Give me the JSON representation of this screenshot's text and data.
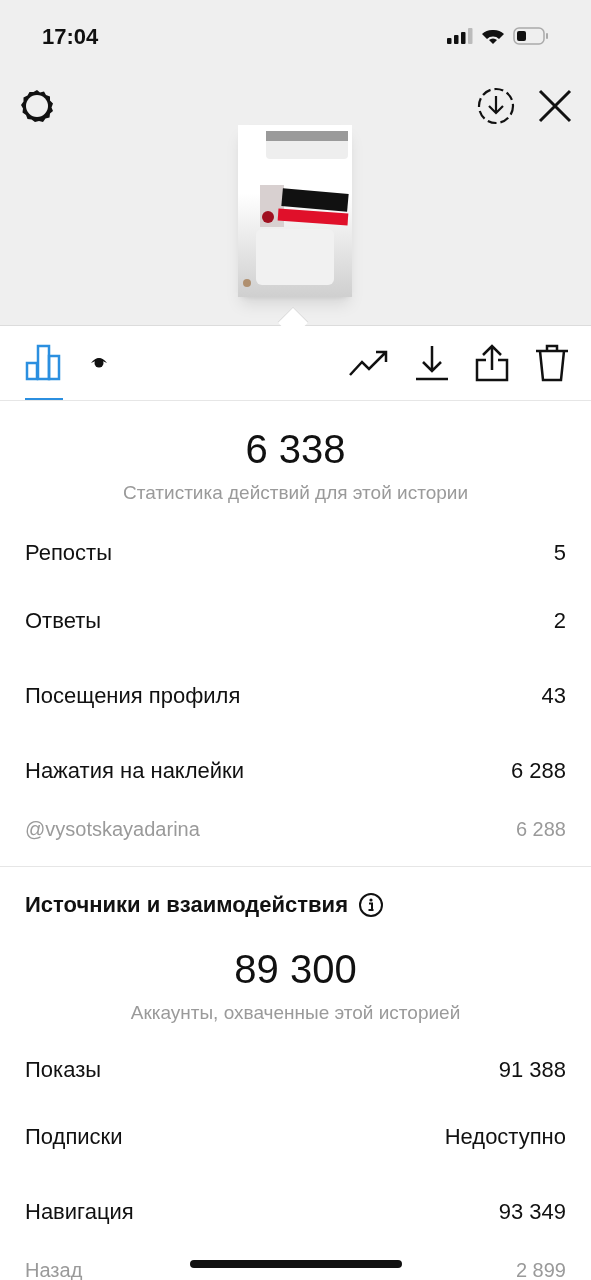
{
  "status_bar": {
    "time": "17:04"
  },
  "tabs": [
    {
      "kind": "stats",
      "selected": true
    },
    {
      "kind": "viewers",
      "selected": false
    }
  ],
  "activity": {
    "value": "6 338",
    "caption": "Статистика действий для этой истории",
    "rows": [
      {
        "kind": "main",
        "label": "Репосты",
        "value": "5"
      },
      {
        "kind": "main",
        "label": "Ответы",
        "value": "2"
      },
      {
        "kind": "main",
        "label": "Посещения профиля",
        "value": "43"
      },
      {
        "kind": "main",
        "label": "Нажатия на наклейки",
        "value": "6 288"
      },
      {
        "kind": "sub",
        "label": "@vysotskayadarina",
        "value": "6 288"
      }
    ]
  },
  "discovery": {
    "title": "Источники и взаимодействия",
    "value": "89 300",
    "caption": "Аккаунты, охваченные этой историей",
    "rows": [
      {
        "kind": "main",
        "label": "Показы",
        "value": "91 388"
      },
      {
        "kind": "main",
        "label": "Подписки",
        "value": "Недоступно"
      },
      {
        "kind": "main",
        "label": "Навигация",
        "value": "93 349"
      },
      {
        "kind": "sub",
        "label": "Назад",
        "value": "2 899"
      }
    ]
  }
}
